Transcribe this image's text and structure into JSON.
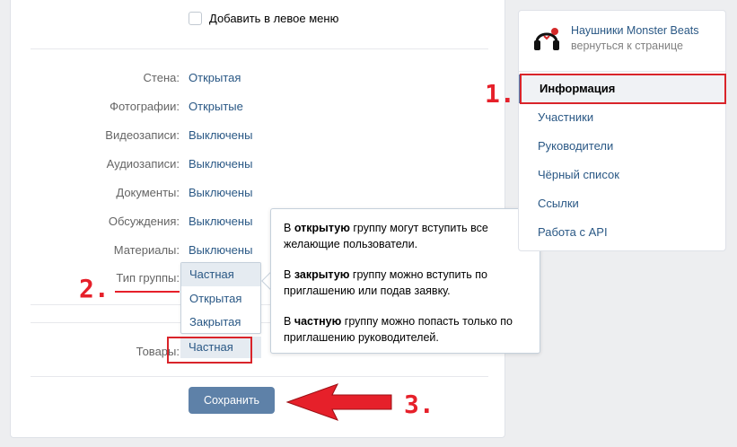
{
  "settings": {
    "add_to_menu_label": "Добавить в левое меню",
    "rows": [
      {
        "label": "Стена:",
        "value": "Открытая"
      },
      {
        "label": "Фотографии:",
        "value": "Открытые"
      },
      {
        "label": "Видеозаписи:",
        "value": "Выключены"
      },
      {
        "label": "Аудиозаписи:",
        "value": "Выключены"
      },
      {
        "label": "Документы:",
        "value": "Выключены"
      },
      {
        "label": "Обсуждения:",
        "value": "Выключены"
      },
      {
        "label": "Материалы:",
        "value": "Выключены"
      }
    ],
    "group_type_label": "Тип группы:",
    "group_type_options": [
      "Частная",
      "Открытая",
      "Закрытая"
    ],
    "group_type_selected": "Частная",
    "goods_label": "Товары:",
    "goods_value": "Частная",
    "save_label": "Сохранить"
  },
  "tooltip": {
    "p1_pre": "В ",
    "p1_bold": "открытую",
    "p1_post": " группу могут вступить все желающие пользователи.",
    "p2_pre": "В ",
    "p2_bold": "закрытую",
    "p2_post": " группу можно вступить по приглашению или подав заявку.",
    "p3_pre": "В ",
    "p3_bold": "частную",
    "p3_post": " группу можно попасть только по приглашению руководителей."
  },
  "sidebar": {
    "group_name": "Наушники Monster Beats",
    "back_link": "вернуться к странице",
    "avatar_icon": "headphones-logo-icon",
    "items": [
      "Информация",
      "Участники",
      "Руководители",
      "Чёрный список",
      "Ссылки",
      "Работа с API"
    ],
    "active_item": "Информация"
  },
  "annotations": {
    "step1": "1.",
    "step2": "2.",
    "step3": "3."
  },
  "colors": {
    "accent": "#5e81a8",
    "link": "#2a5885",
    "annotation_red": "#e6202a"
  }
}
